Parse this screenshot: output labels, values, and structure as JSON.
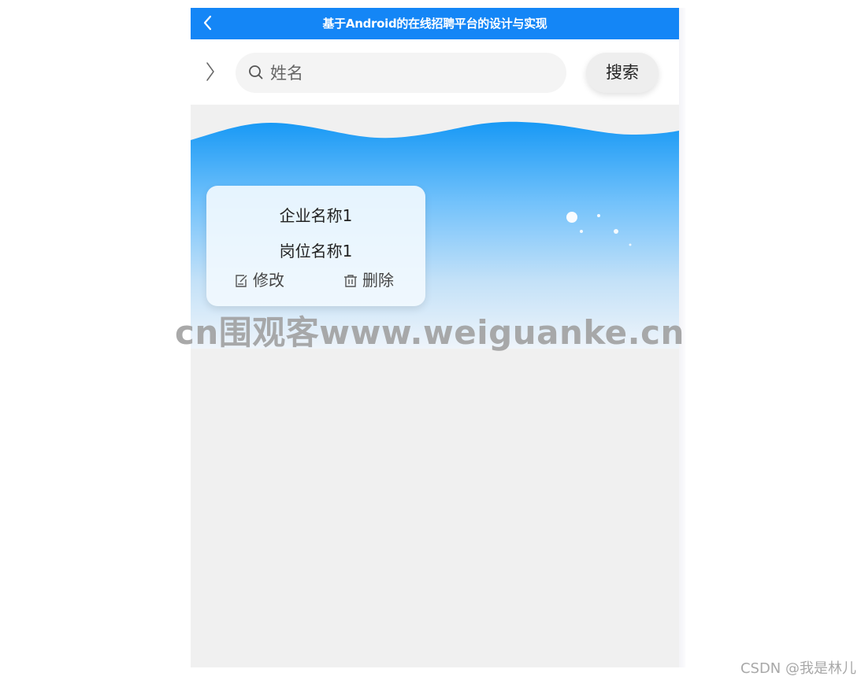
{
  "header": {
    "title": "基于Android的在线招聘平台的设计与实现",
    "back_icon": "chevron-left-icon",
    "background": "#1486f6"
  },
  "search": {
    "toggle_icon": "chevron-right-icon",
    "search_icon": "search-icon",
    "placeholder": "姓名",
    "value": "",
    "button_label": "搜索"
  },
  "cards": [
    {
      "company": "企业名称1",
      "position": "岗位名称1",
      "edit_label": "修改",
      "edit_icon": "edit-icon",
      "delete_label": "删除",
      "delete_icon": "trash-icon"
    }
  ],
  "watermark": "cn围观客www.weiguanke.cn",
  "credit": "CSDN @我是林儿",
  "colors": {
    "accent": "#1486f6",
    "wave_top": "#1899f5",
    "wave_bottom": "#e6f1fb"
  }
}
